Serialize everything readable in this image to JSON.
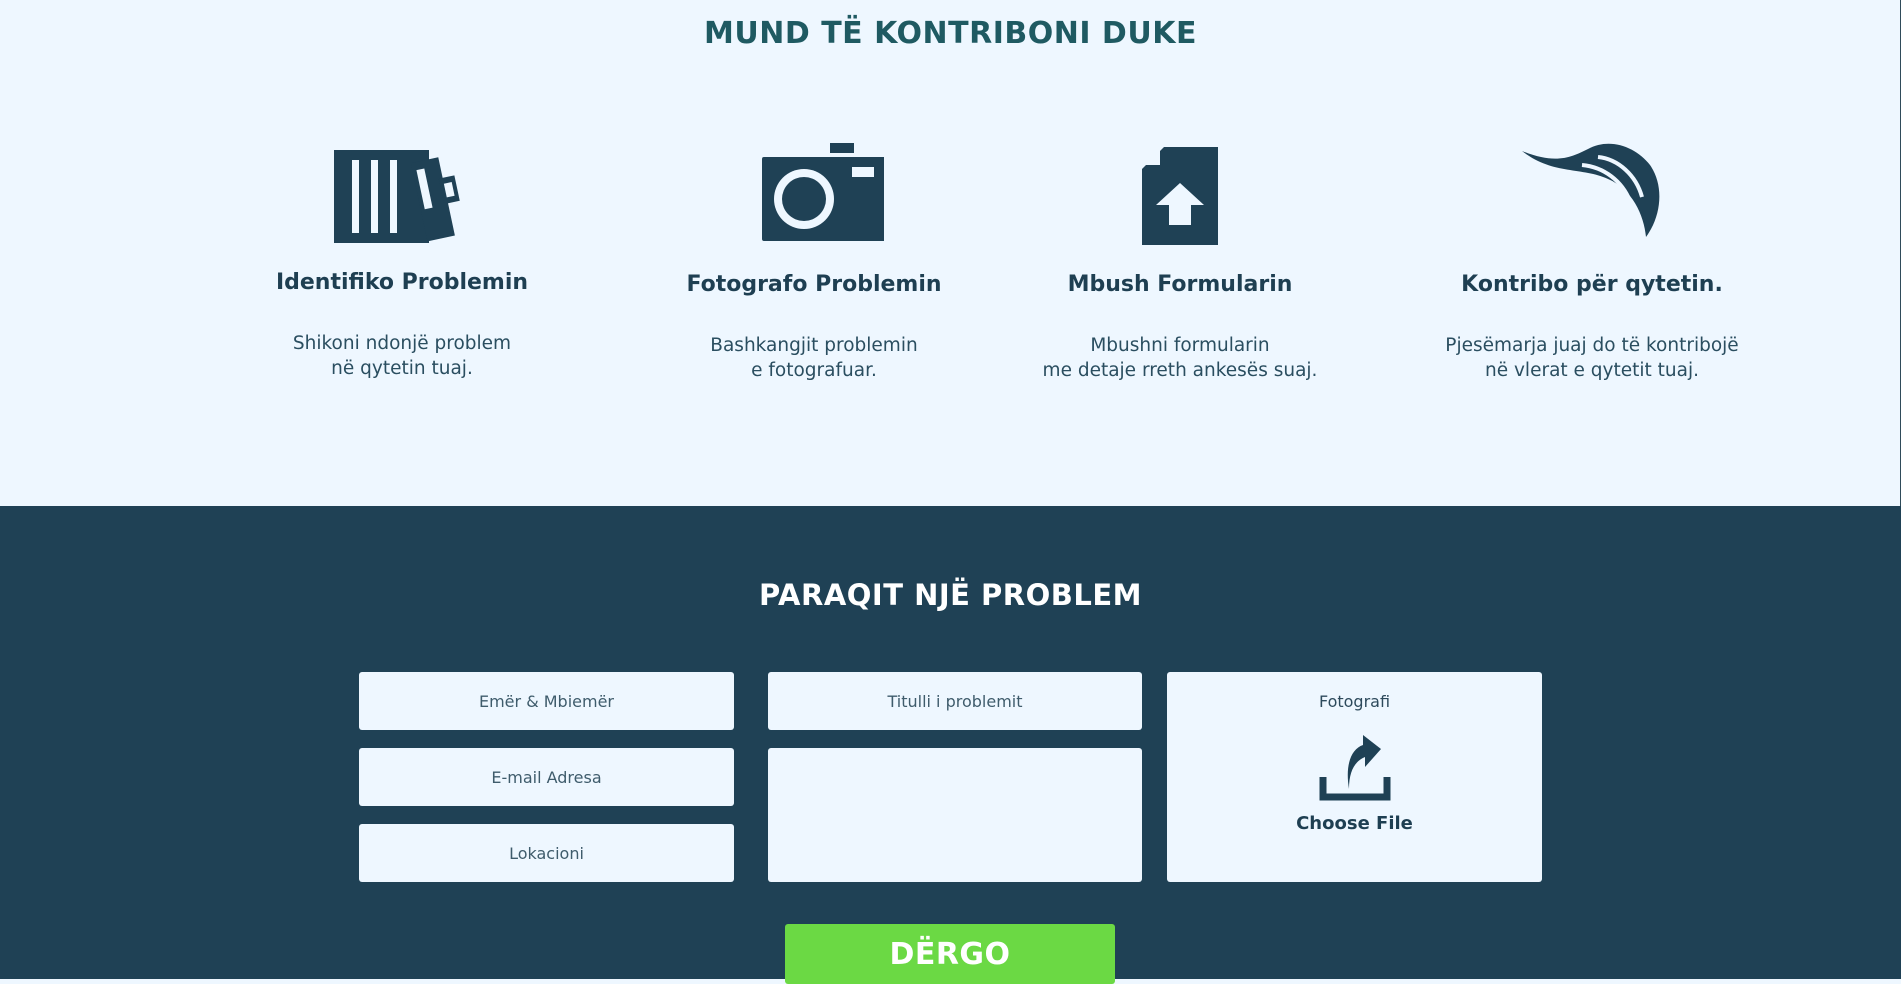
{
  "contribute": {
    "heading": "MUND TË KONTRIBONI DUKE",
    "steps": [
      {
        "icon": "fence-icon",
        "title": "Identifiko Problemin",
        "desc_line1": "Shikoni ndonjë problem",
        "desc_line2": "në qytetin tuaj."
      },
      {
        "icon": "camera-icon",
        "title": "Fotografo Problemin",
        "desc_line1": "Bashkangjit problemin",
        "desc_line2": "e fotografuar."
      },
      {
        "icon": "file-upload-icon",
        "title": "Mbush Formularin",
        "desc_line1": "Mbushni formularin",
        "desc_line2": "me detaje rreth ankesës suaj."
      },
      {
        "icon": "leaf-icon",
        "title": "Kontribo për qytetin.",
        "desc_line1": "Pjesëmarja juaj do të kontribojë",
        "desc_line2": "në vlerat e qytetit tuaj."
      }
    ]
  },
  "form": {
    "heading": "PARAQIT NJË PROBLEM",
    "name_placeholder": "Emër & Mbiemër",
    "email_placeholder": "E-mail Adresa",
    "location_placeholder": "Lokacioni",
    "title_placeholder": "Titulli i problemit",
    "description_placeholder": "",
    "photo_label": "Fotografi",
    "choose_file_label": "Choose File",
    "submit_label": "DËRGO"
  },
  "colors": {
    "background_light": "#eef7ff",
    "section_dark": "#1f4155",
    "accent_green": "#6bd944",
    "heading_teal": "#1f5a62"
  }
}
